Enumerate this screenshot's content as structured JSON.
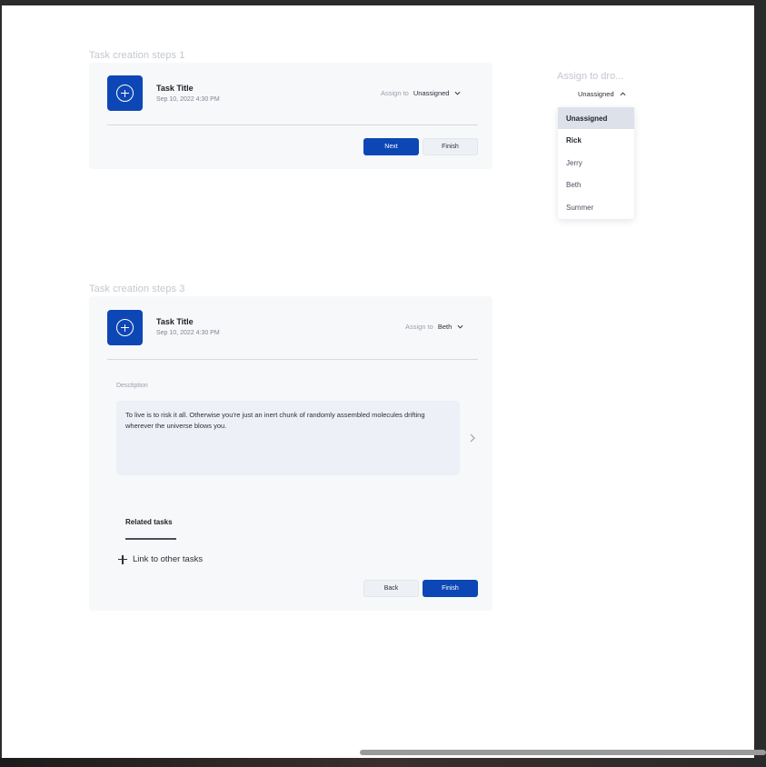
{
  "frames": {
    "step1_label": "Task creation steps 1",
    "step3_label": "Task creation steps 3",
    "dropdown_label": "Assign to dro..."
  },
  "step1": {
    "task_title": "Task Title",
    "task_date": "Sep 10, 2022 4:30 PM",
    "assign_label": "Assign to",
    "assign_value": "Unassigned",
    "next_label": "Next",
    "finish_label": "Finish"
  },
  "dropdown": {
    "trigger_value": "Unassigned",
    "options": [
      "Unassigned",
      "Rick",
      "Jerry",
      "Beth",
      "Summer"
    ],
    "selected": "Unassigned"
  },
  "step3": {
    "task_title": "Task Title",
    "task_date": "Sep 10, 2022 4:30 PM",
    "assign_label": "Assign to",
    "assign_value": "Beth",
    "description_label": "Desctiption",
    "description_text": "To live is to risk it all. Otherwise you're just an inert chunk of randomly assembled molecules drifting wherever the universe blows you.",
    "related_tab": "Related tasks",
    "link_label": "Link to other tasks",
    "back_label": "Back",
    "finish_label": "Finish"
  },
  "colors": {
    "primary": "#0d47b5",
    "card_bg": "#f7f8fa",
    "canvas_bg": "#ffffff"
  }
}
